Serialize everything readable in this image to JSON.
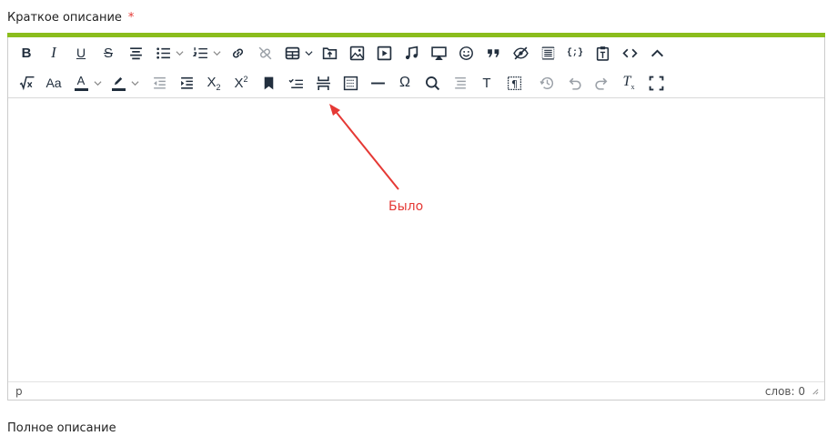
{
  "field": {
    "label": "Краткое описание",
    "required_mark": "*"
  },
  "toolbar": {
    "row1": [
      "bold-icon",
      "italic-icon",
      "underline-icon",
      "strikethrough-icon",
      "align-center-icon",
      "bullet-list-icon",
      "numbered-list-icon",
      "link-icon",
      "unlink-icon",
      "table-icon",
      "upload-icon",
      "image-icon",
      "media-icon",
      "audio-icon",
      "embed-icon",
      "emoticons-icon",
      "blockquote-icon",
      "hide-icon",
      "template-icon",
      "code-sample-icon",
      "paste-text-icon",
      "source-code-icon",
      "collapse-toolbar-icon"
    ],
    "row2": [
      "formula-icon",
      "font-size-icon",
      "text-color-icon",
      "highlight-color-icon",
      "outdent-icon",
      "indent-icon",
      "subscript-icon",
      "superscript-icon",
      "bookmark-icon",
      "checklist-icon",
      "page-break-icon",
      "insert-field-icon",
      "horizontal-rule-icon",
      "special-char-icon",
      "search-icon",
      "line-height-icon",
      "text-icon",
      "show-blocks-icon",
      "history-icon",
      "undo-icon",
      "redo-icon",
      "clear-formatting-icon",
      "fullscreen-icon"
    ],
    "text_color": "#222f3e",
    "highlight_color": "#222f3e"
  },
  "colors": {
    "accent": "#8bbd1d",
    "annotation": "#e53935"
  },
  "statusbar": {
    "path": "p",
    "word_count": "слов: 0"
  },
  "annotation": {
    "text": "Было"
  },
  "next_field": {
    "label": "Полное описание"
  }
}
